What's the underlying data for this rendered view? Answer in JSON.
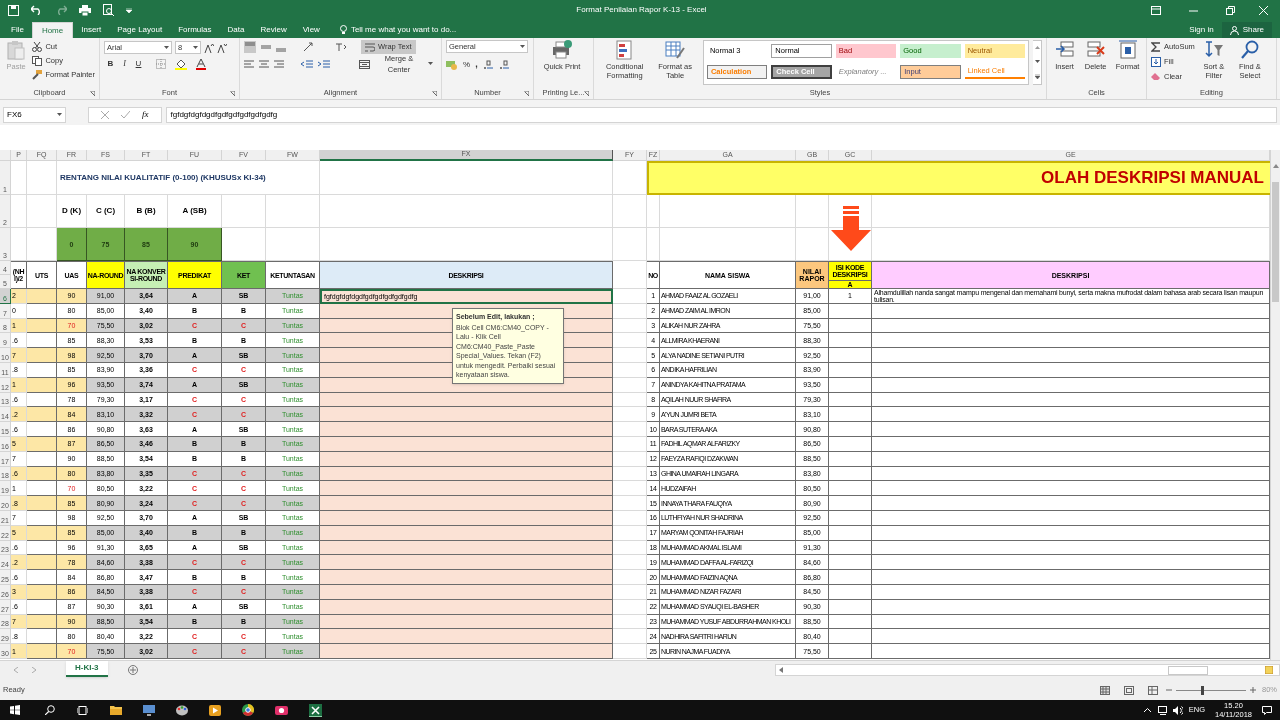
{
  "title_bar": {
    "title": "Format Penilaian Rapor K-13 - Excel"
  },
  "menu_tabs": [
    {
      "label": "File",
      "selected": false
    },
    {
      "label": "Home",
      "selected": true
    },
    {
      "label": "Insert",
      "selected": false
    },
    {
      "label": "Page Layout",
      "selected": false
    },
    {
      "label": "Formulas",
      "selected": false
    },
    {
      "label": "Data",
      "selected": false
    },
    {
      "label": "Review",
      "selected": false
    },
    {
      "label": "View",
      "selected": false
    }
  ],
  "tell_me": "Tell me what you want to do...",
  "sign_in": "Sign in",
  "share": "Share",
  "ribbon": {
    "clipboard": {
      "paste": "Paste",
      "cut": "Cut",
      "copy": "Copy",
      "format_painter": "Format Painter",
      "label": "Clipboard"
    },
    "font": {
      "name": "Arial",
      "size": "8",
      "bold": "B",
      "italic": "I",
      "underline": "U",
      "label": "Font"
    },
    "alignment": {
      "wrap_text": "Wrap Text",
      "wrap_on": true,
      "merge": "Merge & Center",
      "label": "Alignment"
    },
    "number": {
      "format": "General",
      "percent": "%",
      "comma": ",",
      "label": "Number"
    },
    "printing": {
      "quick_print": "Quick Print",
      "label": "Printing Le..."
    },
    "styles": {
      "conditional": "Conditional Formatting",
      "format_table": "Format as Table",
      "label": "Styles",
      "gallery": [
        {
          "label": "Normal 3",
          "kind": "normal3"
        },
        {
          "label": "Normal",
          "kind": "normal"
        },
        {
          "label": "Bad",
          "kind": "bad"
        },
        {
          "label": "Good",
          "kind": "good"
        },
        {
          "label": "Neutral",
          "kind": "neutral"
        },
        {
          "label": "Calculation",
          "kind": "calculation"
        },
        {
          "label": "Check Cell",
          "kind": "check"
        },
        {
          "label": "Explanatory ...",
          "kind": "explanatory"
        },
        {
          "label": "Input",
          "kind": "input"
        },
        {
          "label": "Linked Cell",
          "kind": "linked"
        }
      ]
    },
    "cells": {
      "insert": "Insert",
      "delete": "Delete",
      "format": "Format",
      "label": "Cells"
    },
    "editing": {
      "autosum": "AutoSum",
      "fill": "Fill",
      "clear": "Clear",
      "sort": "Sort & Filter",
      "find": "Find & Select",
      "label": "Editing"
    }
  },
  "formula_bar": {
    "name_box": "FX6",
    "fx": "fx",
    "formula": "fgfdgfdgfdgdfgdfgdfgdfgdfgdfg"
  },
  "columns": [
    "P",
    "FQ",
    "FR",
    "FS",
    "FT",
    "FU",
    "FV",
    "FW",
    "FX",
    "FY",
    "FZ",
    "GA",
    "GB",
    "GC",
    "GE"
  ],
  "sheet": {
    "row_numbers": [
      "1",
      "2",
      "3",
      "4",
      "5"
    ],
    "title_left": "RENTANG NILAI KUALITATIF (0-100) (KHUSUSx KI-34)",
    "title_right": "OLAH DESKRIPSI MANUAL",
    "ranges": [
      {
        "label": "D (K)",
        "min": "0"
      },
      {
        "label": "C (C)",
        "min": "75"
      },
      {
        "label": "B (B)",
        "min": "85"
      },
      {
        "label": "A (SB)",
        "min": "90"
      }
    ],
    "headers_left": [
      {
        "text": "(NH I)/2"
      },
      {
        "text": "UTS"
      },
      {
        "text": "UAS"
      },
      {
        "text": "NA-ROUND",
        "color": "#ffff00"
      },
      {
        "text": "NA KONVERSI-ROUND",
        "color": "#c6efb4"
      },
      {
        "text": "PREDIKAT",
        "color": "#ffff00"
      },
      {
        "text": "KET",
        "color": "#70c050"
      },
      {
        "text": "KETUNTASAN"
      },
      {
        "text": "DESKRIPSI",
        "color": "#ddebf7"
      }
    ],
    "headers_right": {
      "no": "NO",
      "nama": "NAMA SISWA",
      "nilai": "NILAI RAPOR",
      "kode": "ISI KODE DESKRIPSI",
      "kode_sub": "A",
      "deskripsi": "DESKRIPSI"
    },
    "comment": {
      "title": "Sebelum Edit, lakukan ;",
      "text": "Blok Cell  CM6:CM40_COPY - Lalu - Klik Cell CM6:CM40_Paste_Paste Special_Values. Tekan (F2) untuk mengedit. Perbaiki sesuai kenyataan siswa."
    }
  },
  "rows": [
    {
      "row_header": "6",
      "p": "2",
      "uas": "90",
      "uas_low": false,
      "na_round": "91,00",
      "na_konversi": "3,64",
      "predikat": "A",
      "ket": "SB",
      "grade_low": false,
      "ketuntasan": "Tuntas",
      "deskripsi": "fgfdgfdgfdgdfgdfgdfgdfgdfgdfg",
      "selected": true,
      "no": "1",
      "nama": "AHMAD FAAIZ AL GOZAELI",
      "nilai": "91,00",
      "kode": "1",
      "deskripsi_manual": "Alhamdulillah nanda sangat mampu mengenal dan memahami bunyi, serta makna mufrodat dalam bahasa arab secara lisan maupun tulisan."
    },
    {
      "row_header": "7",
      "p": "0",
      "uas": "80",
      "uas_low": false,
      "na_round": "85,00",
      "na_konversi": "3,40",
      "predikat": "B",
      "ket": "B",
      "grade_low": false,
      "ketuntasan": "Tuntas",
      "selected": false,
      "no": "2",
      "nama": "AHMAD ZAIM AL IMRON",
      "nilai": "85,00"
    },
    {
      "row_header": "8",
      "p": "1",
      "uas": "70",
      "uas_low": true,
      "na_round": "75,50",
      "na_konversi": "3,02",
      "predikat": "C",
      "ket": "C",
      "grade_low": true,
      "ketuntasan": "Tuntas",
      "selected": false,
      "no": "3",
      "nama": "ALIKAH NUR ZAHRA",
      "nilai": "75,50"
    },
    {
      "row_header": "9",
      "p": ".6",
      "uas": "85",
      "uas_low": false,
      "na_round": "88,30",
      "na_konversi": "3,53",
      "predikat": "B",
      "ket": "B",
      "grade_low": false,
      "ketuntasan": "Tuntas",
      "selected": false,
      "no": "4",
      "nama": "ALLMIRA KHAERANI",
      "nilai": "88,30"
    },
    {
      "row_header": "10",
      "p": "7",
      "uas": "98",
      "uas_low": false,
      "na_round": "92,50",
      "na_konversi": "3,70",
      "predikat": "A",
      "ket": "SB",
      "grade_low": false,
      "ketuntasan": "Tuntas",
      "selected": false,
      "no": "5",
      "nama": "ALYA NADINE SETIANI PUTRI",
      "nilai": "92,50"
    },
    {
      "row_header": "11",
      "p": ".8",
      "uas": "85",
      "uas_low": false,
      "na_round": "83,90",
      "na_konversi": "3,36",
      "predikat": "C",
      "ket": "C",
      "grade_low": true,
      "ketuntasan": "Tuntas",
      "selected": false,
      "no": "6",
      "nama": "ANDIKA HAFRILIAN",
      "nilai": "83,90"
    },
    {
      "row_header": "12",
      "p": "1",
      "uas": "96",
      "uas_low": false,
      "na_round": "93,50",
      "na_konversi": "3,74",
      "predikat": "A",
      "ket": "SB",
      "grade_low": false,
      "ketuntasan": "Tuntas",
      "selected": false,
      "no": "7",
      "nama": "ANINDYA KAHITNA PRATAMA",
      "nilai": "93,50"
    },
    {
      "row_header": "13",
      "p": ".6",
      "uas": "78",
      "uas_low": false,
      "na_round": "79,30",
      "na_konversi": "3,17",
      "predikat": "C",
      "ket": "C",
      "grade_low": true,
      "ketuntasan": "Tuntas",
      "selected": false,
      "no": "8",
      "nama": "AQILAH NUUR SHAFIRA",
      "nilai": "79,30"
    },
    {
      "row_header": "14",
      "p": ".2",
      "uas": "84",
      "uas_low": false,
      "na_round": "83,10",
      "na_konversi": "3,32",
      "predikat": "C",
      "ket": "C",
      "grade_low": true,
      "ketuntasan": "Tuntas",
      "selected": false,
      "no": "9",
      "nama": "A'YUN JUMRI BETA",
      "nilai": "83,10"
    },
    {
      "row_header": "15",
      "p": ".6",
      "uas": "86",
      "uas_low": false,
      "na_round": "90,80",
      "na_konversi": "3,63",
      "predikat": "A",
      "ket": "SB",
      "grade_low": false,
      "ketuntasan": "Tuntas",
      "selected": false,
      "no": "10",
      "nama": "BARA SUTERA AKA",
      "nilai": "90,80"
    },
    {
      "row_header": "16",
      "p": "5",
      "uas": "87",
      "uas_low": false,
      "na_round": "86,50",
      "na_konversi": "3,46",
      "predikat": "B",
      "ket": "B",
      "grade_low": false,
      "ketuntasan": "Tuntas",
      "selected": false,
      "no": "11",
      "nama": "FADHIL AQMAR ALFARIZKY",
      "nilai": "86,50"
    },
    {
      "row_header": "17",
      "p": "7",
      "uas": "90",
      "uas_low": false,
      "na_round": "88,50",
      "na_konversi": "3,54",
      "predikat": "B",
      "ket": "B",
      "grade_low": false,
      "ketuntasan": "Tuntas",
      "selected": false,
      "no": "12",
      "nama": "FAEYZA RAFIQI DZAKWAN",
      "nilai": "88,50"
    },
    {
      "row_header": "18",
      "p": ".6",
      "uas": "80",
      "uas_low": false,
      "na_round": "83,80",
      "na_konversi": "3,35",
      "predikat": "C",
      "ket": "C",
      "grade_low": true,
      "ketuntasan": "Tuntas",
      "selected": false,
      "no": "13",
      "nama": "GHINA UMAIRAH LINGARA",
      "nilai": "83,80"
    },
    {
      "row_header": "19",
      "p": "1",
      "uas": "70",
      "uas_low": true,
      "na_round": "80,50",
      "na_konversi": "3,22",
      "predikat": "C",
      "ket": "C",
      "grade_low": true,
      "ketuntasan": "Tuntas",
      "selected": false,
      "no": "14",
      "nama": "HUDZAIFAH",
      "nilai": "80,50"
    },
    {
      "row_header": "20",
      "p": ".8",
      "uas": "85",
      "uas_low": false,
      "na_round": "80,90",
      "na_konversi": "3,24",
      "predikat": "C",
      "ket": "C",
      "grade_low": true,
      "ketuntasan": "Tuntas",
      "selected": false,
      "no": "15",
      "nama": "INNAYA THARA FAUQIYA",
      "nilai": "80,90"
    },
    {
      "row_header": "21",
      "p": "7",
      "uas": "98",
      "uas_low": false,
      "na_round": "92,50",
      "na_konversi": "3,70",
      "predikat": "A",
      "ket": "SB",
      "grade_low": false,
      "ketuntasan": "Tuntas",
      "selected": false,
      "no": "16",
      "nama": "LUTHFIYAH NUR SHADRINA",
      "nilai": "92,50"
    },
    {
      "row_header": "22",
      "p": "5",
      "uas": "85",
      "uas_low": false,
      "na_round": "85,00",
      "na_konversi": "3,40",
      "predikat": "B",
      "ket": "B",
      "grade_low": false,
      "ketuntasan": "Tuntas",
      "selected": false,
      "no": "17",
      "nama": "MARYAM QONITAH FAJRIAH",
      "nilai": "85,00"
    },
    {
      "row_header": "23",
      "p": ".6",
      "uas": "96",
      "uas_low": false,
      "na_round": "91,30",
      "na_konversi": "3,65",
      "predikat": "A",
      "ket": "SB",
      "grade_low": false,
      "ketuntasan": "Tuntas",
      "selected": false,
      "no": "18",
      "nama": "MUHAMMAD AKMAL ISLAMI",
      "nilai": "91,30"
    },
    {
      "row_header": "24",
      "p": ".2",
      "uas": "78",
      "uas_low": false,
      "na_round": "84,60",
      "na_konversi": "3,38",
      "predikat": "C",
      "ket": "C",
      "grade_low": true,
      "ketuntasan": "Tuntas",
      "selected": false,
      "no": "19",
      "nama": "MUHAMMAD DAFFA AL-FARIZQI",
      "nilai": "84,60"
    },
    {
      "row_header": "25",
      "p": ".6",
      "uas": "84",
      "uas_low": false,
      "na_round": "86,80",
      "na_konversi": "3,47",
      "predikat": "B",
      "ket": "B",
      "grade_low": false,
      "ketuntasan": "Tuntas",
      "selected": false,
      "no": "20",
      "nama": "MUHAMMAD FAIZIN AQNA",
      "nilai": "86,80"
    },
    {
      "row_header": "26",
      "p": "3",
      "uas": "86",
      "uas_low": false,
      "na_round": "84,50",
      "na_konversi": "3,38",
      "predikat": "C",
      "ket": "C",
      "grade_low": true,
      "ketuntasan": "Tuntas",
      "selected": false,
      "no": "21",
      "nama": "MUHAMMAD NIZAR FAZARI",
      "nilai": "84,50"
    },
    {
      "row_header": "27",
      "p": ".6",
      "uas": "87",
      "uas_low": false,
      "na_round": "90,30",
      "na_konversi": "3,61",
      "predikat": "A",
      "ket": "SB",
      "grade_low": false,
      "ketuntasan": "Tuntas",
      "selected": false,
      "no": "22",
      "nama": "MUHAMMAD SYAUQI EL-BASHER",
      "nilai": "90,30"
    },
    {
      "row_header": "28",
      "p": "7",
      "uas": "90",
      "uas_low": false,
      "na_round": "88,50",
      "na_konversi": "3,54",
      "predikat": "B",
      "ket": "B",
      "grade_low": false,
      "ketuntasan": "Tuntas",
      "selected": false,
      "no": "23",
      "nama": "MUHAMMAD YUSUF ABDURRAHMAN KHOLI",
      "nilai": "88,50"
    },
    {
      "row_header": "29",
      "p": ".8",
      "uas": "80",
      "uas_low": false,
      "na_round": "80,40",
      "na_konversi": "3,22",
      "predikat": "C",
      "ket": "C",
      "grade_low": true,
      "ketuntasan": "Tuntas",
      "selected": false,
      "no": "24",
      "nama": "NADHIRA SAFITRI HARUN",
      "nilai": "80,40"
    },
    {
      "row_header": "30",
      "p": "1",
      "uas": "70",
      "uas_low": true,
      "na_round": "75,50",
      "na_konversi": "3,02",
      "predikat": "C",
      "ket": "C",
      "grade_low": true,
      "ketuntasan": "Tuntas",
      "selected": false,
      "no": "25",
      "nama": "NURIN NAJMA FUADIYA",
      "nilai": "75,50"
    }
  ],
  "sheet_tabs": [
    {
      "label": "H-KI-3",
      "selected": true
    }
  ],
  "status_bar": {
    "ready": "Ready",
    "zoom": {
      "level": 0.36
    },
    "zoom_text": "80%"
  },
  "taskbar": {
    "language": "ENG",
    "time": "15.20",
    "date": "14/11/2018"
  }
}
